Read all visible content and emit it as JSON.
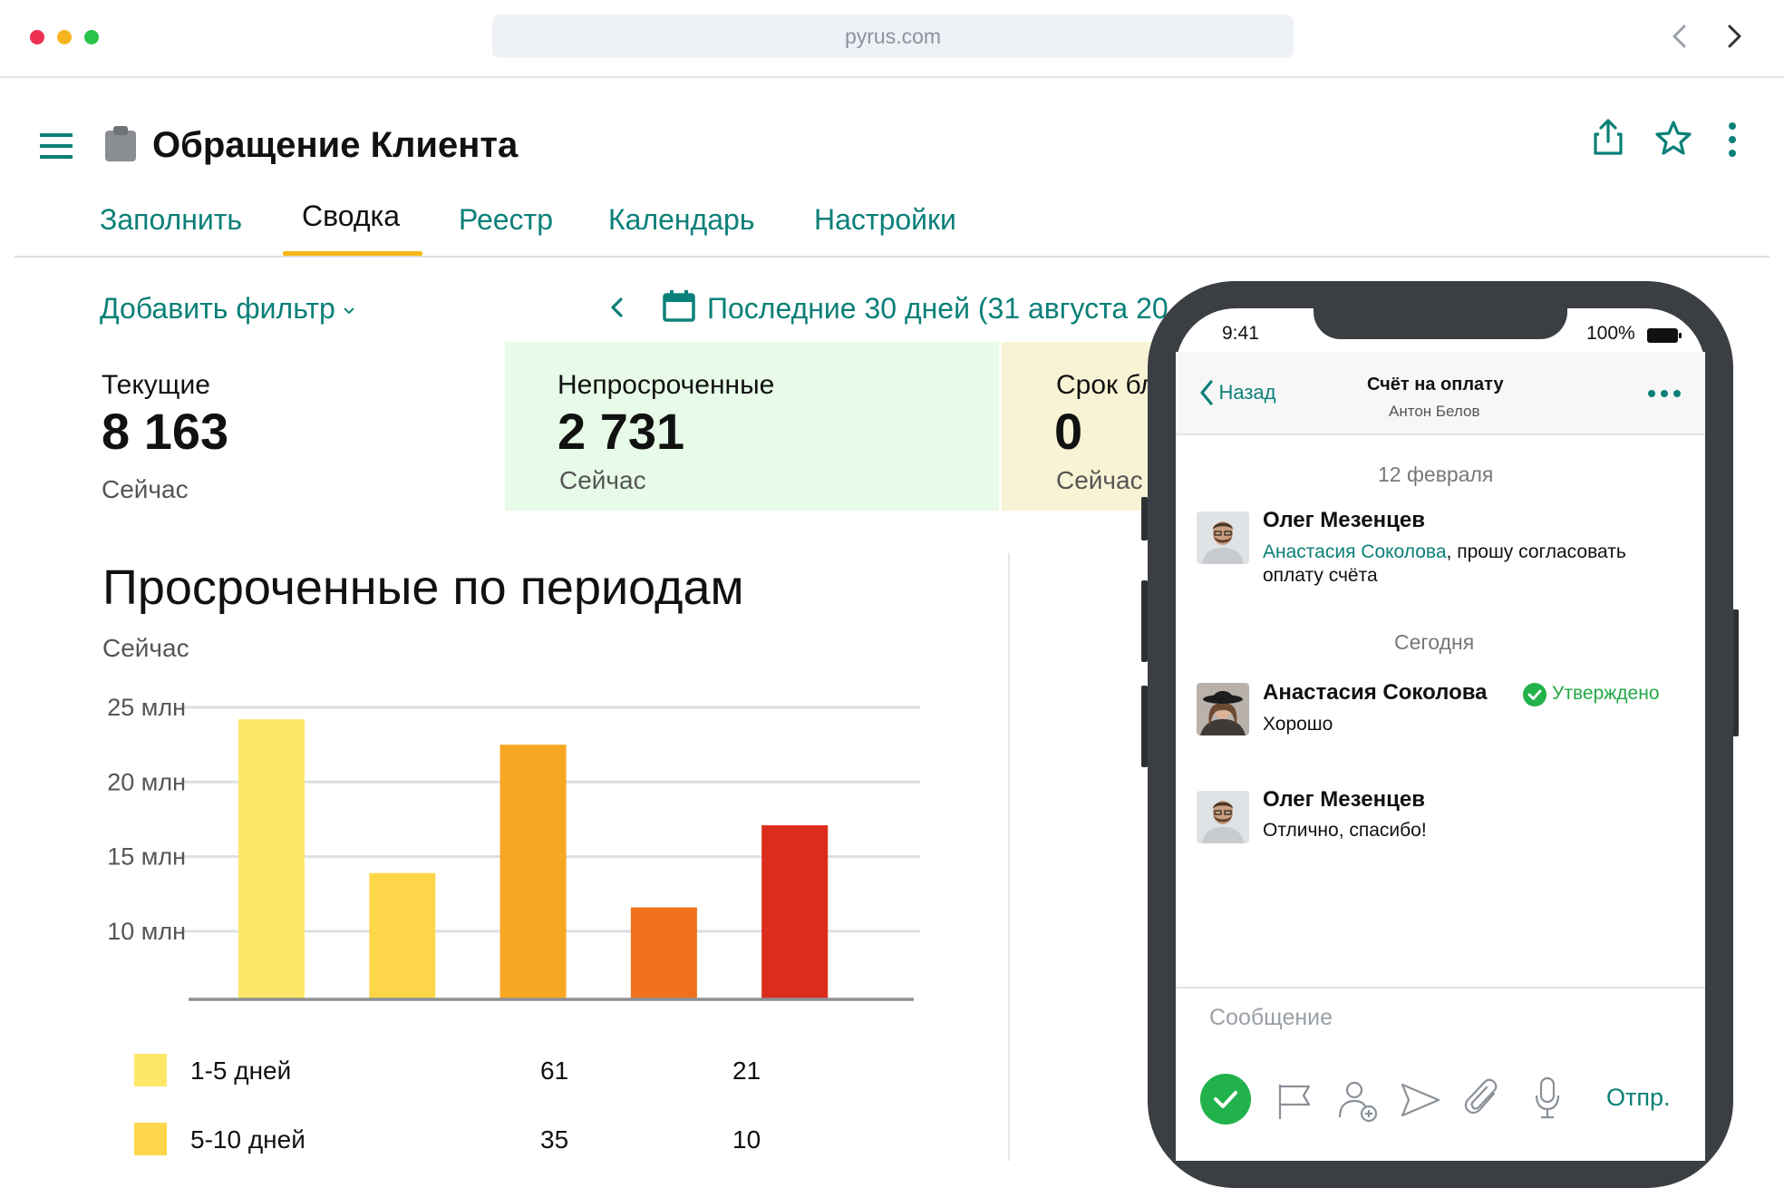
{
  "browser": {
    "url": "pyrus.com",
    "dot_colors": [
      "#ee3152",
      "#f6b51e",
      "#29c24b"
    ]
  },
  "header": {
    "title": "Обращение Клиента"
  },
  "tabs": [
    {
      "label": "Заполнить",
      "active": false
    },
    {
      "label": "Сводка",
      "active": true
    },
    {
      "label": "Реестр",
      "active": false
    },
    {
      "label": "Календарь",
      "active": false
    },
    {
      "label": "Настройки",
      "active": false
    }
  ],
  "filters": {
    "add_filter": "Добавить фильтр",
    "period": "Последние 30 дней (31 августа 20"
  },
  "stats": [
    {
      "label": "Текущие",
      "value": "8 163",
      "sub": "Сейчас",
      "bg": "#ffffff"
    },
    {
      "label": "Непросроченные",
      "value": "2 731",
      "sub": "Сейчас",
      "bg": "#e7fbe8"
    },
    {
      "label": "Срок бл",
      "value": "0",
      "sub": "Сейчас",
      "bg": "#f8f3d4"
    }
  ],
  "chart": {
    "title": "Просроченные по периодам",
    "subtitle": "Сейчас"
  },
  "chart_data": {
    "type": "bar",
    "title": "Просроченные по периодам",
    "subtitle": "Сейчас",
    "y_tick_labels": [
      "25 млн",
      "20 млн",
      "15 млн",
      "10 млн"
    ],
    "y_ticks": [
      25,
      20,
      15,
      10
    ],
    "ylim": [
      5.5,
      25
    ],
    "grid": true,
    "values": [
      24.2,
      13.9,
      22.5,
      11.6,
      17.1
    ],
    "bar_colors": [
      "#ffe867",
      "#ffd64a",
      "#f7a722",
      "#ef711c",
      "#dc2c1c"
    ]
  },
  "legend": [
    {
      "label": "1-5 дней",
      "v1": "61",
      "v2": "21",
      "color": "#ffe867"
    },
    {
      "label": "5-10 дней",
      "v1": "35",
      "v2": "10",
      "color": "#ffd64a"
    }
  ],
  "phone": {
    "time": "9:41",
    "battery": "100%",
    "back": "Назад",
    "title": "Счёт на оплату",
    "subtitle": "Антон Белов",
    "date1": "12 февраля",
    "date2": "Сегодня",
    "messages": [
      {
        "author": "Олег Мезенцев",
        "mention": "Анастасия Соколова",
        "text_line1": ", прошу согласовать",
        "text_line2": "оплату счёта"
      },
      {
        "author": "Анастасия Соколова",
        "status": "Утверждено",
        "text": "Хорошо"
      },
      {
        "author": "Олег Мезенцев",
        "text": "Отлично, спасибо!"
      }
    ],
    "input_placeholder": "Сообщение",
    "send": "Отпр."
  }
}
